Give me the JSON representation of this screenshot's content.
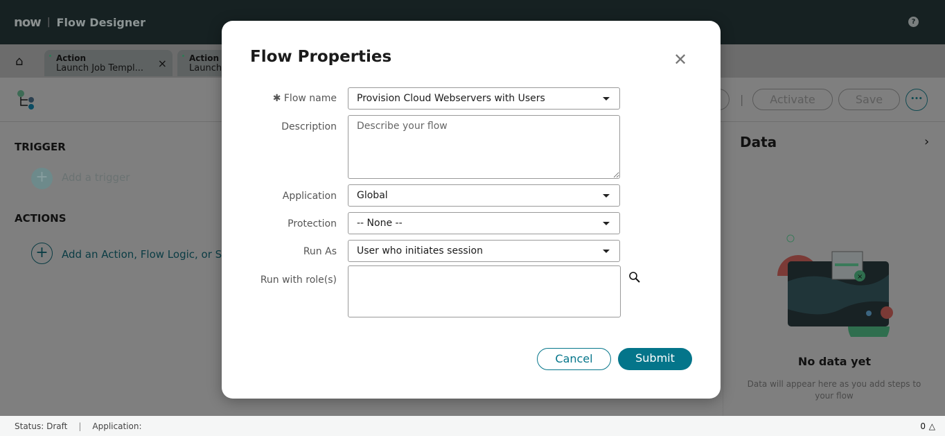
{
  "header": {
    "logo": "now",
    "app_title": "Flow Designer",
    "help": "?"
  },
  "tabs": [
    {
      "type": "Action",
      "title": "Launch Job Templ..."
    },
    {
      "type": "Action",
      "title": "Launch"
    }
  ],
  "toolbar": {
    "activate": "Activate",
    "save": "Save",
    "more": "•••"
  },
  "left": {
    "trigger_heading": "TRIGGER",
    "add_trigger": "Add a trigger",
    "actions_heading": "ACTIONS",
    "add_action": "Add an Action, Flow Logic, or Subflow"
  },
  "data_panel": {
    "title": "Data",
    "empty_title": "No data yet",
    "empty_text": "Data will appear here as you add steps to your flow"
  },
  "status": {
    "status": "Status: Draft",
    "application": "Application:",
    "notifications": "0"
  },
  "modal": {
    "title": "Flow Properties",
    "flow_name_label": "Flow name",
    "flow_name": "Provision Cloud Webservers with Users",
    "description_label": "Description",
    "description_placeholder": "Describe your flow",
    "application_label": "Application",
    "application": "Global",
    "protection_label": "Protection",
    "protection": "-- None --",
    "run_as_label": "Run As",
    "run_as": "User who initiates session",
    "roles_label": "Run with role(s)",
    "cancel": "Cancel",
    "submit": "Submit"
  },
  "colors": {
    "accent": "#04758a",
    "header": "#162122"
  }
}
